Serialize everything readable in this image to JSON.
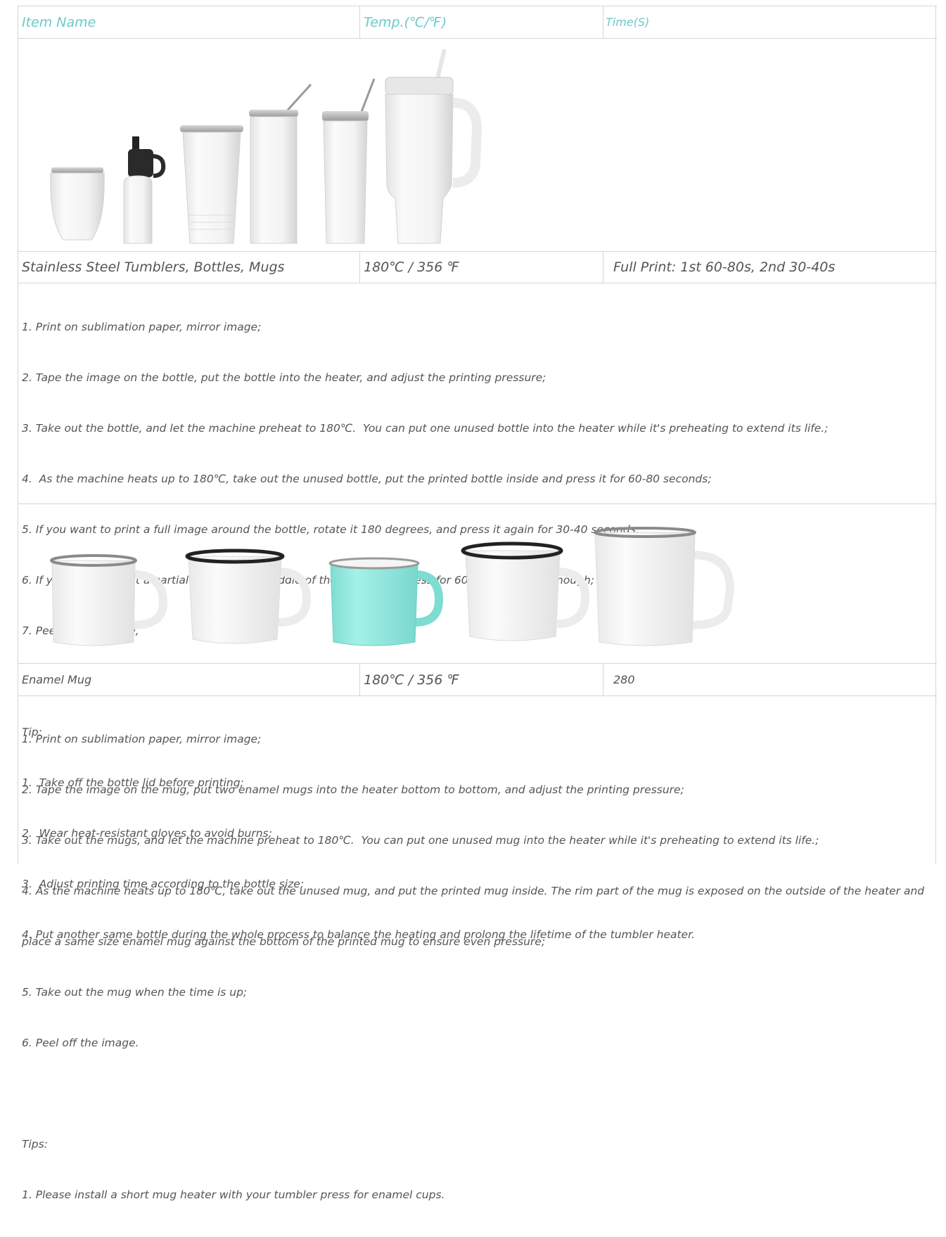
{
  "header": {
    "item_name": "Item Name",
    "temp": "Temp.(℃/℉)",
    "time": "Time(S)"
  },
  "products": [
    {
      "name": "Stainless Steel Tumblers, Bottles, Mugs",
      "temp": "180℃ / 356 ℉",
      "time": "Full Print: 1st 60-80s, 2nd 30-40s",
      "image_alt": "tumblers-bottles-mugs-photo",
      "steps": [
        "1. Print on sublimation paper, mirror image;",
        "2. Tape the image on the bottle, put the bottle into the heater, and adjust the printing pressure;",
        "3. Take out the bottle, and let the machine preheat to 180℃.  You can put one unused bottle into the heater while it's preheating to extend its life.;",
        "4.  As the machine heats up to 180℃, take out the unused bottle, put the printed bottle inside and press it for 60-80 seconds;",
        "5. If you want to print a full image around the bottle, rotate it 180 degrees, and press it again for 30-40 seconds;",
        "6. If you want to print a partial image in the middle of the bottle, one press for 60-80 seconds is enough;",
        "7. Peel off the image,",
        "",
        "Tip:",
        "1.  Take off the bottle lid before printing;",
        "2.  Wear heat-resistant gloves to avoid burns;",
        "3.  Adjust printing time according to the bottle size;",
        "4. Put another same bottle during the whole process to balance the heating and prolong the lifetime of the tumbler heater."
      ]
    },
    {
      "name": "Enamel Mug",
      "temp": "180℃ / 356 ℉",
      "time": "280",
      "image_alt": "enamel-mugs-photo",
      "steps": [
        "1. Print on sublimation paper, mirror image;",
        "2. Tape the image on the mug, put two enamel mugs into the heater bottom to bottom, and adjust the printing pressure;",
        "3. Take out the mugs, and let the machine preheat to 180℃.  You can put one unused mug into the heater while it's preheating to extend its life.;",
        "4. As the machine heats up to 180℃, take out the unused mug, and put the printed mug inside. The rim part of the mug is exposed on the outside of the heater and",
        "place a same size enamel mug against the bottom of the printed mug to ensure even pressure;",
        "5. Take out the mug when the time is up;",
        "6. Peel off the image.",
        "",
        "Tips:",
        "1. Please install a short mug heater with your tumbler press for enamel cups."
      ]
    }
  ],
  "colors": {
    "header_text": "#6cc9c9",
    "border": "#d6d6d6",
    "body_text": "#555555",
    "turquoise_mug": "#8fe8de"
  }
}
